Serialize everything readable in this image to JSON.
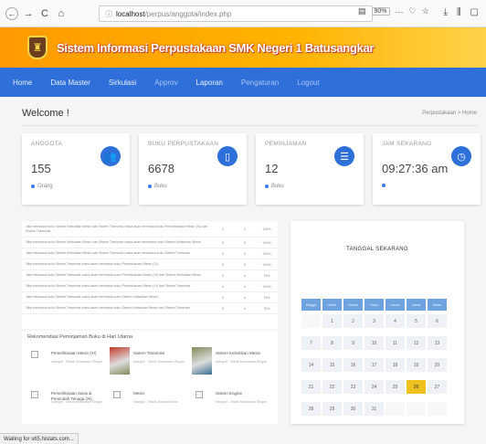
{
  "browser": {
    "url_host": "localhost",
    "url_path": "/perpus/anggota/index.php",
    "zoom": "90%",
    "menu_dots": "···",
    "status": "Waiting for s65.histats.com..."
  },
  "app": {
    "title": "Sistem Informasi Perpustakaan SMK Negeri 1 Batusangkar"
  },
  "menu": [
    {
      "label": "Home",
      "dim": false
    },
    {
      "label": "Data Master",
      "dim": false
    },
    {
      "label": "Sirkulasi",
      "dim": false
    },
    {
      "label": "Approv",
      "dim": true
    },
    {
      "label": "Laporan",
      "dim": false
    },
    {
      "label": "Pengaturan",
      "dim": true
    },
    {
      "label": "Logout",
      "dim": true
    }
  ],
  "page": {
    "welcome": "Welcome !",
    "breadcrumb": "Perpustakaan > Home"
  },
  "cards": [
    {
      "label": "ANGGOTA",
      "value": "155",
      "sub": "Orang",
      "icon": "users-icon",
      "glyph": "👥"
    },
    {
      "label": "BUKU PERPUSTAKAAN",
      "value": "6678",
      "sub": "Buku",
      "icon": "tablet-icon",
      "glyph": "▯"
    },
    {
      "label": "PEMINJAMAN",
      "value": "12",
      "sub": "Buku",
      "icon": "list-icon",
      "glyph": "☰"
    },
    {
      "label": "JAM SEKARANG",
      "value": "09:27:36 am",
      "sub": "",
      "icon": "clock-icon",
      "glyph": "◷"
    }
  ],
  "table_rows": [
    {
      "title": "Jika membaca buku Sistem Kelistrikan Mesin dan Sistem Transmisi maka akan membaca buku Pemeliharaan Mesin (XI) dan Sistem Transmisi",
      "n1": "3",
      "n2": "3",
      "p": "100%"
    },
    {
      "title": "Jika membaca buku Sistem Kelistrikan Mesin dan Sistem Transmisi maka akan membaca buku Sistem Kelistrikan Mesin",
      "n1": "3",
      "n2": "3",
      "p": "100%"
    },
    {
      "title": "Jika membaca buku Sistem Kelistrikan Mesin dan Sistem Transmisi maka akan membaca buku Sistem Transmisi",
      "n1": "3",
      "n2": "3",
      "p": "100%"
    },
    {
      "title": "Jika membaca buku Sistem Transmisi maka akan membaca buku Pemeliharaan Mesin (XI)",
      "n1": "3",
      "n2": "3",
      "p": "100%"
    },
    {
      "title": "Jika membaca buku Sistem Transmisi maka akan membaca buku Pemeliharaan Mesin (XI) dan Sistem Kelistrikan Mesin",
      "n1": "3",
      "n2": "4",
      "p": "75%"
    },
    {
      "title": "Jika membaca buku Sistem Transmisi maka akan membaca buku Pemeliharaan Mesin (XI) dan Sistem Transmisi",
      "n1": "4",
      "n2": "4",
      "p": "100%"
    },
    {
      "title": "Jika membaca buku Sistem Transmisi maka akan membaca buku Sistem Kelistrikan Mesin",
      "n1": "3",
      "n2": "4",
      "p": "75%"
    },
    {
      "title": "Jika membaca buku Sistem Transmisi maka akan membaca buku Sistem Kelistrikan Mesin dan Sistem Transmisi",
      "n1": "3",
      "n2": "4",
      "p": "75%"
    }
  ],
  "recommendation": {
    "title": "Rekomendasi Peminjaman Buku di Hari Utama",
    "books": [
      {
        "name": "Pemeliharaan Mesin (XI)",
        "meta": "Kategori : Teknik Kendaraan Ringan",
        "img": "broken"
      },
      {
        "name": "Sistem Transmisi",
        "meta": "Kategori : Teknik Kendaraan Ringan",
        "img": "cover"
      },
      {
        "name": "Sistem Kelistrikan Mesin",
        "meta": "Kategori : Teknik Kendaraan Ringan",
        "img": "cover"
      },
      {
        "name": "Pemeliharaan Sasis & Pemindah Tenaga (XI)",
        "meta": "Kategori : Teknik Kendaraan Ringan",
        "img": "broken"
      },
      {
        "name": "Mesin",
        "meta": "Kategori : Teknik Sepeda Motor",
        "img": "broken"
      },
      {
        "name": "Sistem Engine",
        "meta": "Kategori : Teknik Kendaraan Ringan",
        "img": "broken"
      }
    ]
  },
  "calendar": {
    "title": "TANGGAL SEKARANG",
    "days": [
      "Minggu",
      "Senin",
      "Selasa",
      "Rabu",
      "Kamis",
      "Jumat",
      "Sabtu"
    ],
    "dates": [
      "",
      "1",
      "2",
      "3",
      "4",
      "5",
      "6",
      "7",
      "8",
      "9",
      "10",
      "11",
      "12",
      "13",
      "14",
      "15",
      "16",
      "17",
      "18",
      "19",
      "20",
      "21",
      "22",
      "23",
      "24",
      "25",
      "26",
      "27",
      "28",
      "29",
      "30",
      "31",
      "",
      "",
      ""
    ],
    "today": "26"
  }
}
